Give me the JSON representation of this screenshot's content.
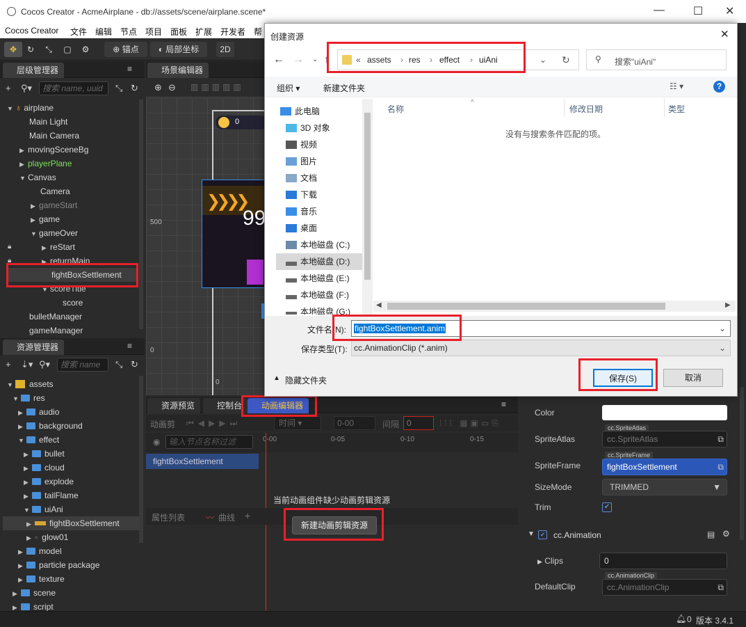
{
  "window": {
    "title": "Cocos Creator - AcmeAirplane - db://assets/scene/airplane.scene*",
    "minimize": "—",
    "maximize": "☐",
    "close": "✕"
  },
  "menubar": [
    "Cocos Creator",
    "文件",
    "编辑",
    "节点",
    "项目",
    "面板",
    "扩展",
    "开发者",
    "帮"
  ],
  "toolbar": {
    "anchor": "锚点",
    "local": "局部坐标",
    "mode2d": "2D"
  },
  "hierarchy": {
    "title": "层级管理器",
    "search_placeholder": "搜索 name, uuid",
    "items": [
      {
        "label": "airplane"
      },
      {
        "label": "Main Light"
      },
      {
        "label": "Main Camera"
      },
      {
        "label": "movingSceneBg"
      },
      {
        "label": "playerPlane"
      },
      {
        "label": "Canvas"
      },
      {
        "label": "Camera"
      },
      {
        "label": "gameStart"
      },
      {
        "label": "game"
      },
      {
        "label": "gameOver"
      },
      {
        "label": "reStart"
      },
      {
        "label": "returnMain"
      },
      {
        "label": "fightBoxSettlement"
      },
      {
        "label": "scoreTitle"
      },
      {
        "label": "score"
      },
      {
        "label": "bulletManager"
      },
      {
        "label": "gameManager"
      }
    ]
  },
  "assets": {
    "title": "资源管理器",
    "search_placeholder": "搜索 name",
    "items": [
      {
        "label": "assets"
      },
      {
        "label": "res"
      },
      {
        "label": "audio"
      },
      {
        "label": "background"
      },
      {
        "label": "effect"
      },
      {
        "label": "bullet"
      },
      {
        "label": "cloud"
      },
      {
        "label": "explode"
      },
      {
        "label": "tailFlame"
      },
      {
        "label": "uiAni"
      },
      {
        "label": "fightBoxSettlement"
      },
      {
        "label": "glow01"
      },
      {
        "label": "model"
      },
      {
        "label": "particle package"
      },
      {
        "label": "texture"
      },
      {
        "label": "scene"
      },
      {
        "label": "script"
      }
    ]
  },
  "scene": {
    "title": "场景编辑器",
    "ruler_500": "500",
    "ruler_0": "0",
    "ruler_0b": "0",
    "score": "0",
    "big": "99"
  },
  "bottom_tabs": {
    "preview": "资源预览",
    "console": "控制台",
    "anim": "动画编辑器"
  },
  "anim_editor": {
    "clip_label": "动画剪",
    "time_label": "时间",
    "time_value": "0-00",
    "interval_label": "间隔",
    "interval_value": "0",
    "node_search_placeholder": "输入节点名称过滤",
    "ticks": [
      "0-00",
      "0-05",
      "0-10",
      "0-15"
    ],
    "node": "fightBoxSettlement",
    "prop_list": "属性列表",
    "curve": "曲线",
    "missing_msg": "当前动画组件缺少动画剪辑资源",
    "new_clip_btn": "新建动画剪辑资源"
  },
  "inspector": {
    "color_label": "Color",
    "atlas_label": "SpriteAtlas",
    "atlas_tag": "cc.SpriteAtlas",
    "atlas_value": "cc.SpriteAtlas",
    "frame_label": "SpriteFrame",
    "frame_tag": "cc.SpriteFrame",
    "frame_value": "fightBoxSettlement",
    "sizemode_label": "SizeMode",
    "sizemode_value": "TRIMMED",
    "trim_label": "Trim",
    "anim_comp": "cc.Animation",
    "clips_label": "Clips",
    "clips_value": "0",
    "default_label": "DefaultClip",
    "default_tag": "cc.AnimationClip",
    "default_value": "cc.AnimationClip"
  },
  "status": {
    "bell_count": "0",
    "version": "版本 3.4.1"
  },
  "dialog": {
    "title": "创建资源",
    "close": "✕",
    "breadcrumb": [
      "assets",
      "res",
      "effect",
      "uiAni"
    ],
    "search_placeholder": "搜索\"uiAni\"",
    "organize": "组织 ▾",
    "new_folder": "新建文件夹",
    "nav": [
      "此电脑",
      "3D 对象",
      "视频",
      "图片",
      "文档",
      "下载",
      "音乐",
      "桌面",
      "本地磁盘 (C:)",
      "本地磁盘 (D:)",
      "本地磁盘 (E:)",
      "本地磁盘 (F:)",
      "本地磁盘 (G:)"
    ],
    "col_name": "名称",
    "col_date": "修改日期",
    "col_type": "类型",
    "empty_msg": "没有与搜索条件匹配的项。",
    "filename_label": "文件名(N):",
    "filename_value": "fightBoxSettlement.anim",
    "savetype_label": "保存类型(T):",
    "savetype_value": "cc.AnimationClip (*.anim)",
    "hide_folders": "隐藏文件夹",
    "save_btn": "保存(S)",
    "cancel_btn": "取消"
  }
}
